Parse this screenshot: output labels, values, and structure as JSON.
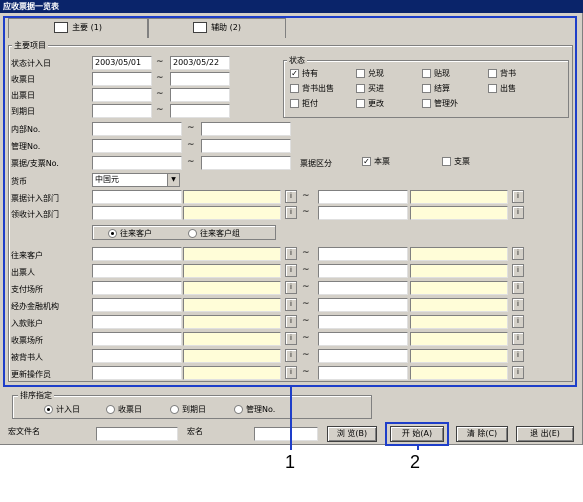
{
  "window": {
    "title": "应收票据一览表"
  },
  "tabs": [
    {
      "label": "主要 (1)"
    },
    {
      "label": "辅助 (2)"
    }
  ],
  "main": {
    "group_label": "主要项目",
    "rows": {
      "status_date": {
        "label": "状态计入日",
        "from": "2003/05/01",
        "to": "2003/05/22"
      },
      "receive_date": {
        "label": "收票日"
      },
      "issue_date": {
        "label": "出票日"
      },
      "due_date": {
        "label": "到期日"
      },
      "internal_no": {
        "label": "内部No."
      },
      "manage_no": {
        "label": "管理No."
      },
      "bill_no": {
        "label": "票据/支票No."
      },
      "currency": {
        "label": "货币",
        "value": "中国元"
      },
      "bill_dept": {
        "label": "票据计入部门"
      },
      "collect_dept": {
        "label": "领收计入部门"
      },
      "client": {
        "label": "往来客户"
      },
      "drawer": {
        "label": "出票人"
      },
      "pay_place": {
        "label": "支付场所"
      },
      "bank": {
        "label": "经办金融机构"
      },
      "account": {
        "label": "入款账户"
      },
      "receive_place": {
        "label": "收票场所"
      },
      "endorser": {
        "label": "被背书人"
      },
      "updater": {
        "label": "更新操作员"
      }
    },
    "status": {
      "label": "状态",
      "items": [
        {
          "label": "持有",
          "checked": true
        },
        {
          "label": "兑现",
          "checked": false
        },
        {
          "label": "贴现",
          "checked": false
        },
        {
          "label": "背书",
          "checked": false
        },
        {
          "label": "背书出售",
          "checked": false
        },
        {
          "label": "买进",
          "checked": false
        },
        {
          "label": "结算",
          "checked": false
        },
        {
          "label": "出售",
          "checked": false
        },
        {
          "label": "拒付",
          "checked": false
        },
        {
          "label": "更改",
          "checked": false
        },
        {
          "label": "管理外",
          "checked": false
        }
      ]
    },
    "bill_type": {
      "label": "票据区分",
      "opt1": "本票",
      "opt2": "支票"
    },
    "client_radio": {
      "opt1": "往来客户",
      "opt2": "往来客户组"
    },
    "tilde": "~",
    "browse_glyph": "i"
  },
  "sort": {
    "label": "排序指定",
    "options": [
      "计入日",
      "收票日",
      "到期日",
      "管理No."
    ]
  },
  "footer": {
    "macro_file_label": "宏文件名",
    "macro_label": "宏名",
    "browse": "浏 览(B)",
    "start": "开 始(A)",
    "clear": "清 除(C)",
    "exit": "退 出(E)"
  },
  "callouts": {
    "one": "1",
    "two": "2"
  }
}
